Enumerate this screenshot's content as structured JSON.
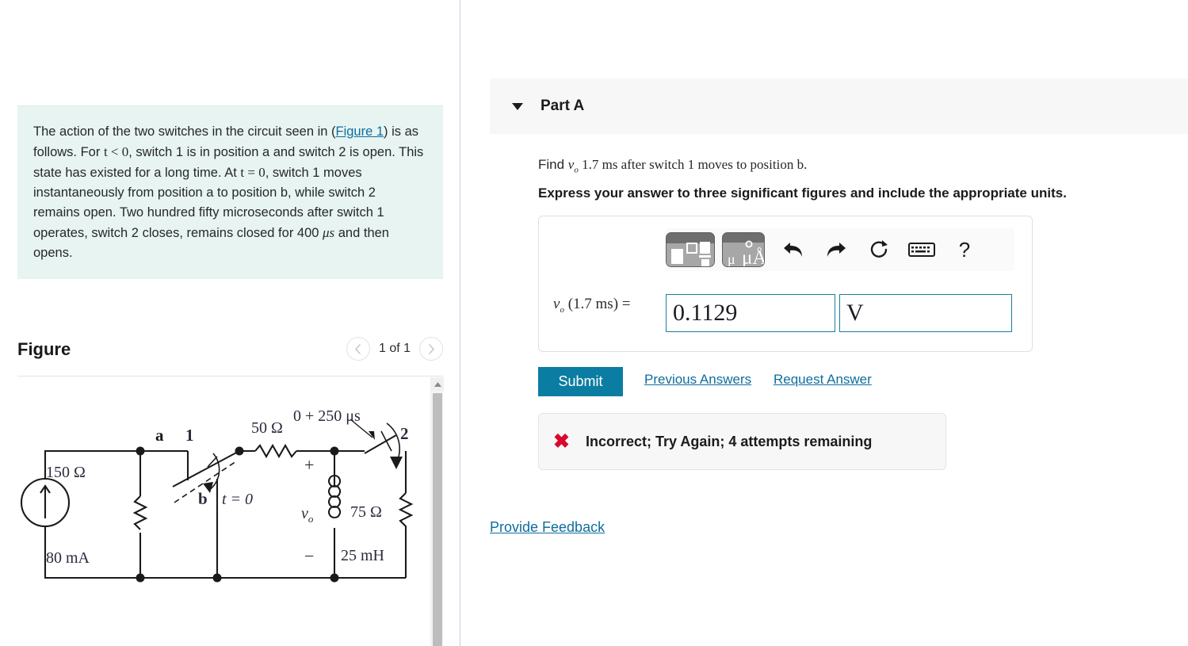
{
  "problem": {
    "intro_1": "The action of the two switches in the circuit seen in (",
    "figure_link": "Figure 1",
    "intro_2": ") is as follows. For ",
    "cond_1": "t < 0",
    "intro_3": ", switch 1 is in position a and switch 2 is open. This state has existed for a long time. At ",
    "cond_2": "t = 0",
    "intro_4": ", switch 1 moves instantaneously from position a to position b, while switch 2 remains open. Two hundred fifty microseconds after switch 1 operates, switch 2 closes, remains closed for 400 ",
    "unit_us": "μs",
    "intro_5": " and then opens."
  },
  "figure": {
    "title": "Figure",
    "count_label": "1 of 1",
    "prev_icon": "chevron-left-icon",
    "next_icon": "chevron-right-icon",
    "scroll_up_icon": "scroll-up-arrow-icon"
  },
  "circuit": {
    "source_current": "80 mA",
    "r_left": "150 Ω",
    "r_series": "50 Ω",
    "r_right": "75 Ω",
    "inductor": "25 mH",
    "v_out": "v",
    "v_out_sub": "o",
    "plus": "+",
    "minus": "−",
    "switch1_label": "1",
    "switch1_pos_a": "a",
    "switch1_pos_b": "b",
    "switch1_time": "t = 0",
    "switch2_label": "2",
    "switch2_time": "0 + 250 μs"
  },
  "part": {
    "caret_icon": "caret-down-icon",
    "title": "Part A",
    "question_pre": "Find ",
    "question_var": "v",
    "question_var_sub": "o",
    "question_post": " 1.7 ms after switch 1 moves to position b.",
    "instruction": "Express your answer to three significant figures and include the appropriate units."
  },
  "toolbar": {
    "template_button": "math-template-button",
    "units_button_label": "μÅ",
    "undo_icon": "undo-arrow-icon",
    "redo_icon": "redo-arrow-icon",
    "reset_icon": "reset-circular-arrow-icon",
    "keyboard_icon": "keyboard-icon",
    "help_icon": "question-mark-icon",
    "help_label": "?"
  },
  "answer": {
    "label_var": "v",
    "label_sub": "o",
    "label_time": "(1.7 ms)",
    "label_equals": "=",
    "value": "0.1129",
    "unit": "V",
    "value_placeholder": "",
    "unit_placeholder": ""
  },
  "actions": {
    "submit_label": "Submit",
    "previous_answers_label": "Previous Answers",
    "request_answer_label": "Request Answer",
    "provide_feedback_label": "Provide Feedback"
  },
  "feedback": {
    "status_icon": "red-x-icon",
    "status_mark": "✖",
    "message": "Incorrect; Try Again; 4 attempts remaining"
  },
  "colors": {
    "accent_teal": "#0b7da2",
    "link_blue": "#0d6e9e",
    "problem_bg": "#e7f4f2",
    "error_red": "#d8082c",
    "input_border": "#1a7e9e"
  }
}
